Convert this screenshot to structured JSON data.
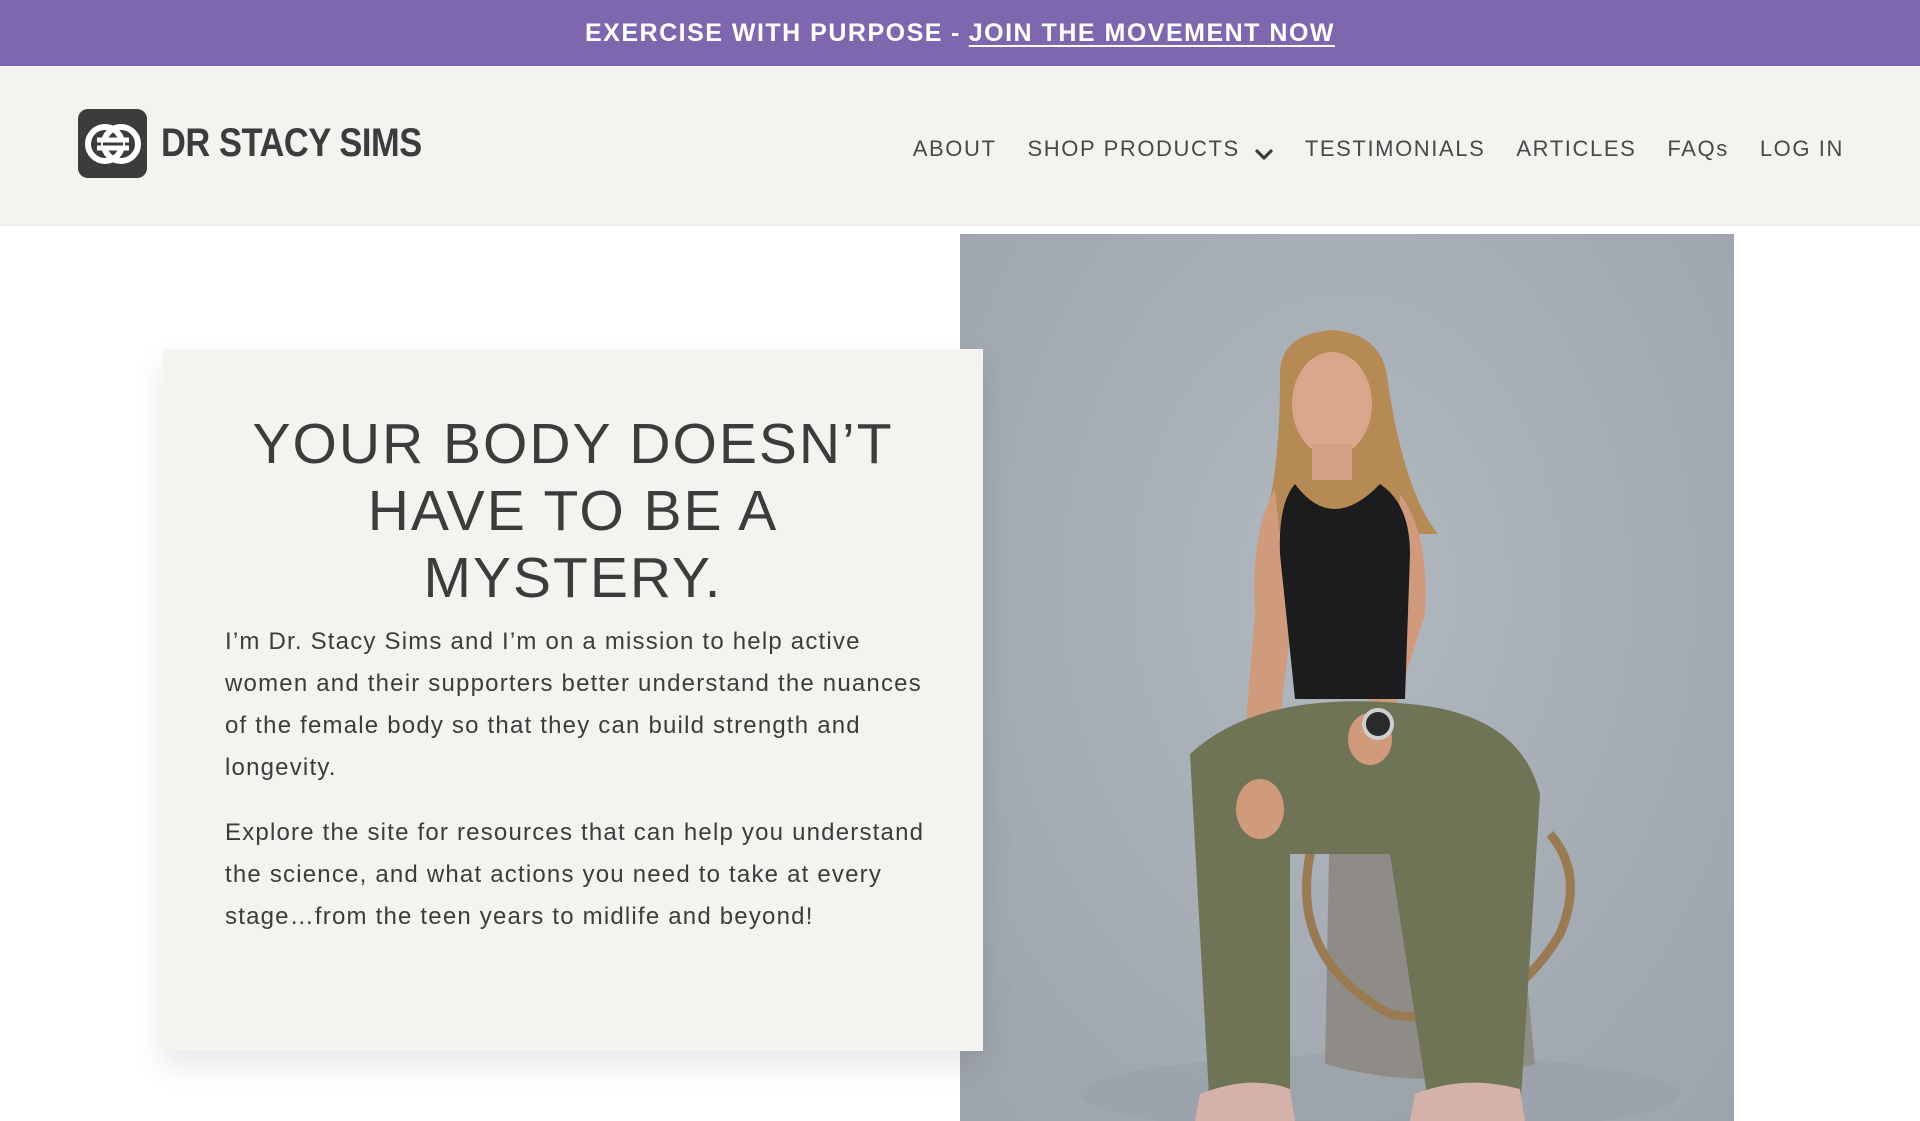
{
  "announcement": {
    "text": "EXERCISE WITH PURPOSE",
    "separator": "-",
    "link": "JOIN THE MOVEMENT NOW"
  },
  "brand": {
    "name": "DR STACY SIMS",
    "logo_icon": "ss-monogram-icon"
  },
  "nav": {
    "items": [
      {
        "label": "ABOUT"
      },
      {
        "label": "SHOP PRODUCTS",
        "icon": "chevron-down-icon"
      },
      {
        "label": "TESTIMONIALS"
      },
      {
        "label": "ARTICLES"
      },
      {
        "label": "FAQs"
      },
      {
        "label": "LOG IN"
      }
    ]
  },
  "hero": {
    "heading_lines": [
      "YOUR BODY DOESN’T",
      "HAVE TO BE A",
      "MYSTERY."
    ],
    "paragraph_1": "I’m Dr. Stacy Sims and I’m on a mission to help active women and their supporters better understand the nuances of the female body so that they can build strength and longevity.",
    "paragraph_2": "Explore the site for resources that can help you understand the science, and what actions you need to take at every stage…from the teen years to midlife and beyond!"
  },
  "colors": {
    "announcement_bg": "#7e67af",
    "header_bg": "#f4f3ef",
    "text": "#3d3b3b",
    "photo_bg": "#a8aeb6"
  }
}
